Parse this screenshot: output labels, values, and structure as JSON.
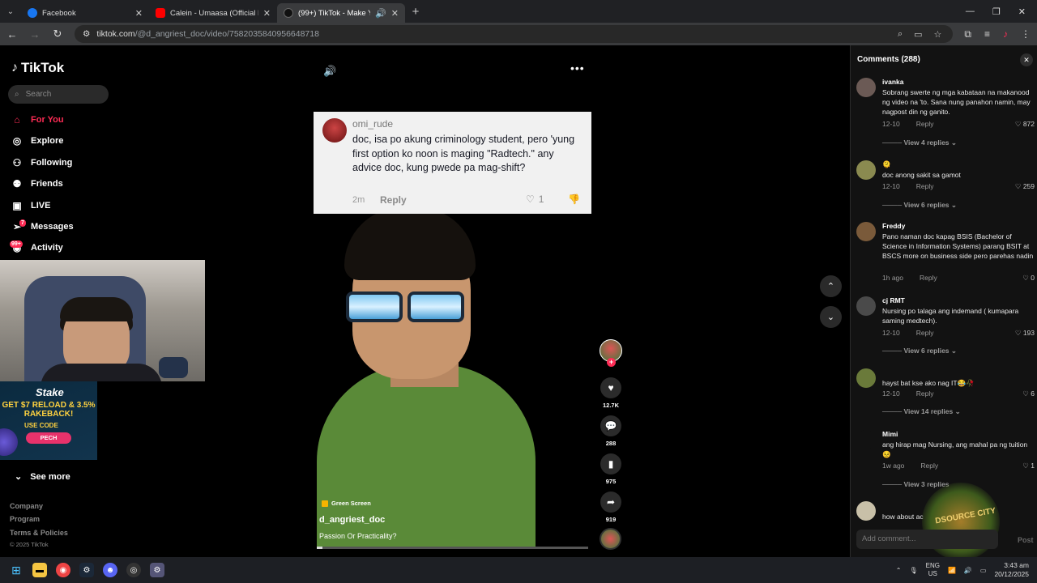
{
  "browser": {
    "tabs": [
      {
        "title": "Facebook",
        "favicon": "facebook-icon",
        "active": false
      },
      {
        "title": "Calein - Umaasa (Official Lyric V",
        "favicon": "youtube-icon",
        "active": false
      },
      {
        "title": "(99+) TikTok - Make Your Da",
        "favicon": "tiktok-icon",
        "active": true
      }
    ],
    "url_host": "tiktok.com",
    "url_path": "/@d_angriest_doc/video/7582035840956648718"
  },
  "sidebar": {
    "logo": "TikTok",
    "search_placeholder": "Search",
    "nav": [
      {
        "label": "For You",
        "icon": "home-icon",
        "active": true
      },
      {
        "label": "Explore",
        "icon": "compass-icon",
        "active": false
      },
      {
        "label": "Following",
        "icon": "following-icon",
        "active": false
      },
      {
        "label": "Friends",
        "icon": "friends-icon",
        "active": false
      },
      {
        "label": "LIVE",
        "icon": "live-icon",
        "active": false
      },
      {
        "label": "Messages",
        "icon": "messages-icon",
        "active": false,
        "badge": "7"
      },
      {
        "label": "Activity",
        "icon": "activity-icon",
        "active": false,
        "badge": "99+"
      }
    ],
    "see_more": "See more",
    "footer": [
      "Company",
      "Program",
      "Terms & Policies"
    ],
    "copyright": "© 2025 TikTok"
  },
  "ad": {
    "brand": "Stake",
    "promo": "GET $7 RELOAD & 3.5% RAKEBACK!",
    "use_code": "USE CODE",
    "code": "PECH"
  },
  "video": {
    "reply_card": {
      "username": "omi_rude",
      "text": "doc, isa po akung criminology student, pero 'yung first option ko noon is maging \"Radtech.\" any advice doc, kung pwede pa mag-shift?",
      "time": "2m",
      "reply": "Reply",
      "likes": "1"
    },
    "tag": "Green Screen",
    "username": "d_angriest_doc",
    "description": "Passion Or Practicality?",
    "progress": 0.0,
    "likes": "12.7K",
    "comments": "288",
    "saves": "975",
    "shares": "919"
  },
  "comments_panel": {
    "title": "Comments (288)",
    "items": [
      {
        "name": "ivanka",
        "text": "Sobrang swerte ng mga kabataan na makanood ng video na 'to. Sana nung panahon namin, may nagpost din ng ganito.",
        "date": "12-10",
        "reply": "Reply",
        "likes": "872",
        "replies": "View 4 replies"
      },
      {
        "name": "🫠",
        "text": "doc anong sakit sa gamot",
        "date": "12-10",
        "reply": "Reply",
        "likes": "259",
        "replies": "View 6 replies"
      },
      {
        "name": "Freddy",
        "text": "Pano naman doc kapag BSIS (Bachelor of Science in Information Systems) parang BSIT at BSCS more on business side pero parehas nadin",
        "date": "1h ago",
        "reply": "Reply",
        "likes": "0",
        "replies": ""
      },
      {
        "name": "cj RMT",
        "text": "Nursing po talaga ang indemand ( kumapara saming medtech).",
        "date": "12-10",
        "reply": "Reply",
        "likes": "193",
        "replies": "View 6 replies"
      },
      {
        "name": "",
        "text": "hayst bat kse ako nag IT😂🥀",
        "date": "12-10",
        "reply": "Reply",
        "likes": "6",
        "replies": "View 14 replies"
      },
      {
        "name": "Mimi",
        "text": "ang hirap mag Nursing, ang mahal pa ng tuition 😣",
        "date": "1w ago",
        "reply": "Reply",
        "likes": "1",
        "replies": "View 3 replies"
      },
      {
        "name": "",
        "text": "how about ac",
        "date": "",
        "reply": "",
        "likes": "",
        "replies": ""
      }
    ],
    "add_placeholder": "Add comment...",
    "post": "Post"
  },
  "taskbar": {
    "lang": "ENG",
    "region": "US",
    "time": "3:43 am",
    "date": "20/12/2025"
  },
  "colors": {
    "accent": "#fe2c55",
    "background": "#000000",
    "panel": "#121212"
  }
}
